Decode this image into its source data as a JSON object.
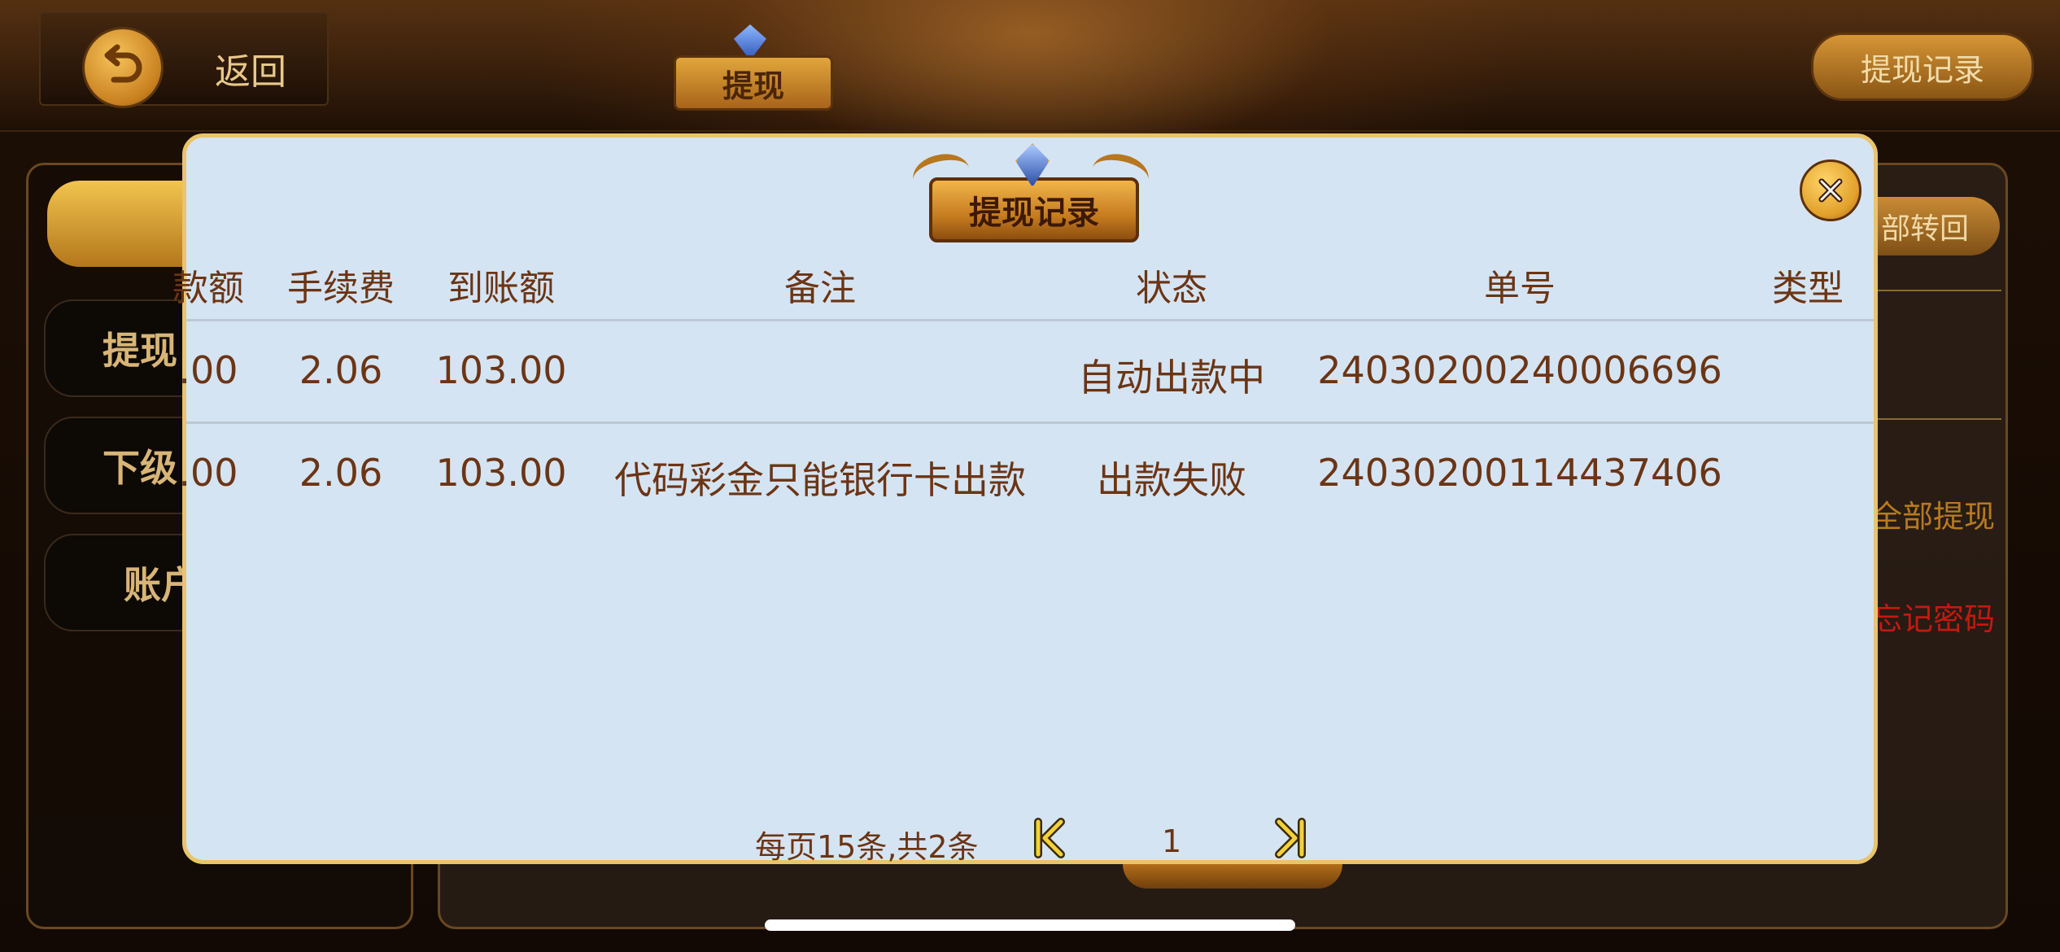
{
  "header": {
    "back_label": "返回",
    "title": "提现",
    "record_button": "提现记录"
  },
  "sidebar": {
    "items": [
      {
        "label": "提现"
      },
      {
        "label": "下级"
      },
      {
        "label": "账户"
      }
    ]
  },
  "right_panel": {
    "button_partial": "部转回",
    "withdraw_all": "全部提现",
    "forgot_password": "忘记密码"
  },
  "modal": {
    "title": "提现记录",
    "columns": {
      "amount_partial": "款额",
      "fee": "手续费",
      "received": "到账额",
      "remark": "备注",
      "status": "状态",
      "order_no": "单号",
      "type": "类型"
    },
    "rows": [
      {
        "amount": ".00",
        "fee": "2.06",
        "received": "103.00",
        "remark": "",
        "status": "自动出款中",
        "order_no": "24030200240006696",
        "type": ""
      },
      {
        "amount": ".00",
        "fee": "2.06",
        "received": "103.00",
        "remark": "代码彩金只能银行卡出款",
        "status": "出款失败",
        "order_no": "24030200114437406",
        "type": ""
      }
    ],
    "pager": {
      "summary": "每页15条,共2条",
      "current_page": "1"
    }
  },
  "colors": {
    "modal_bg": "#d5e4f3",
    "modal_border": "#e9c46c",
    "table_text": "#6b3515",
    "gold": "#d69636",
    "warning_red": "#c21a10"
  },
  "icons": [
    "back-arrow-icon",
    "close-icon",
    "first-page-icon",
    "last-page-icon"
  ]
}
